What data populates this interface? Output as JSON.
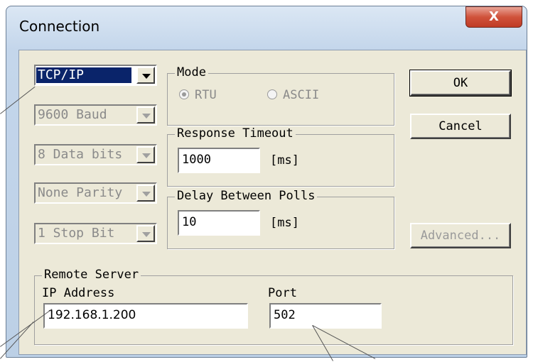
{
  "window": {
    "title": "Connection",
    "close_glyph": "X"
  },
  "connection_type": {
    "value": "TCP/IP"
  },
  "serial": {
    "baud": "9600 Baud",
    "data_bits": "8 Data bits",
    "parity": "None Parity",
    "stop_bits": "1 Stop Bit"
  },
  "mode": {
    "label": "Mode",
    "options": [
      "RTU",
      "ASCII"
    ],
    "selected": "RTU"
  },
  "response_timeout": {
    "label": "Response Timeout",
    "value": "1000",
    "unit": "[ms]"
  },
  "delay_between_polls": {
    "label": "Delay Between Polls",
    "value": "10",
    "unit": "[ms]"
  },
  "buttons": {
    "ok": "OK",
    "cancel": "Cancel",
    "advanced": "Advanced..."
  },
  "remote_server": {
    "label": "Remote Server",
    "ip_label": "IP Address",
    "ip_value": "192.168.1.200",
    "port_label": "Port",
    "port_value": "502"
  },
  "icons": {
    "dropdown": "chevron-down-icon",
    "close": "close-icon"
  }
}
